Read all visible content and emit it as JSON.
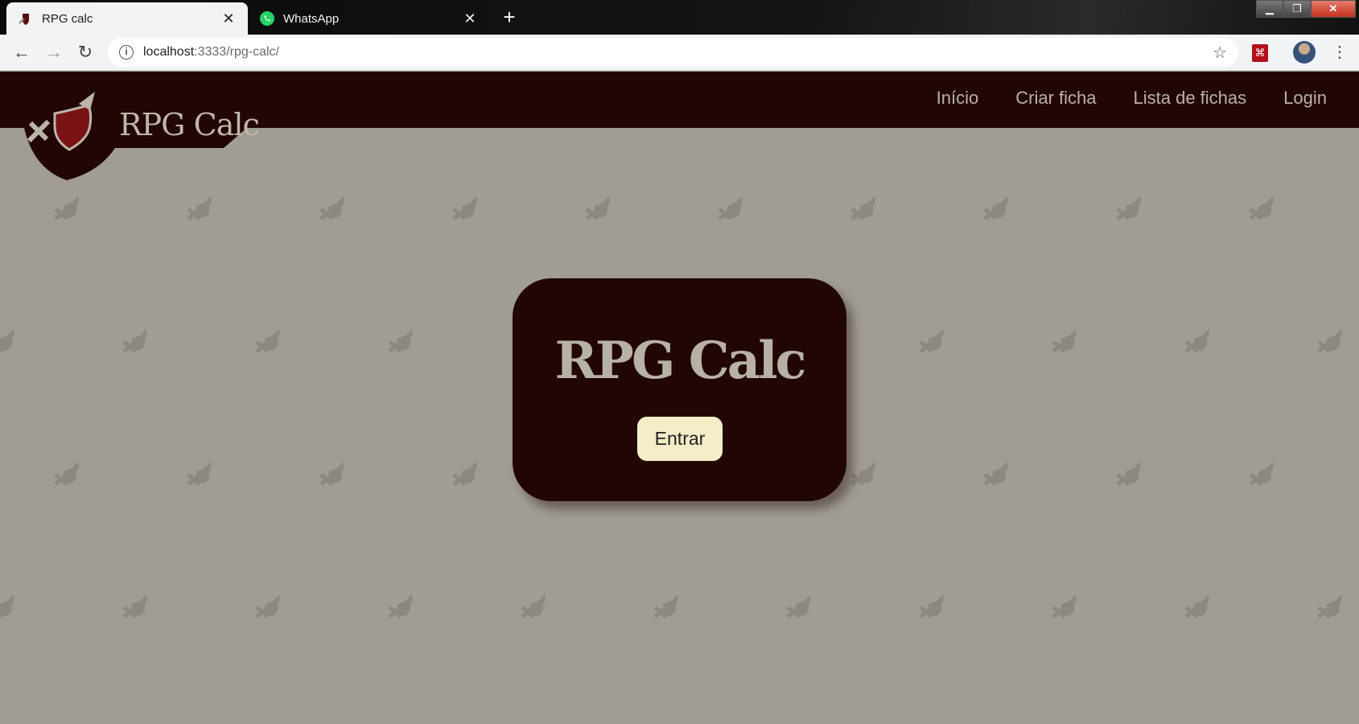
{
  "browser": {
    "tabs": [
      {
        "title": "RPG calc",
        "active": true
      },
      {
        "title": "WhatsApp",
        "active": false
      }
    ],
    "new_tab_symbol": "+",
    "close_symbol": "✕",
    "address": {
      "host": "localhost",
      "rest": ":3333/rpg-calc/"
    },
    "icons": [
      "back-arrow-icon",
      "forward-arrow-icon",
      "reload-icon",
      "info-icon",
      "star-icon",
      "pdf-extension-icon",
      "profile-avatar-icon",
      "more-menu-icon"
    ]
  },
  "site": {
    "brand": "RPG Calc",
    "nav": [
      "Início",
      "Criar ficha",
      "Lista de fichas",
      "Login"
    ],
    "colors": {
      "header": "#220505",
      "background": "#a19d95",
      "button": "#f5ecc8",
      "text_light": "#b9b3a9"
    }
  },
  "hero": {
    "title": "RPG Calc",
    "button_label": "Entrar"
  }
}
